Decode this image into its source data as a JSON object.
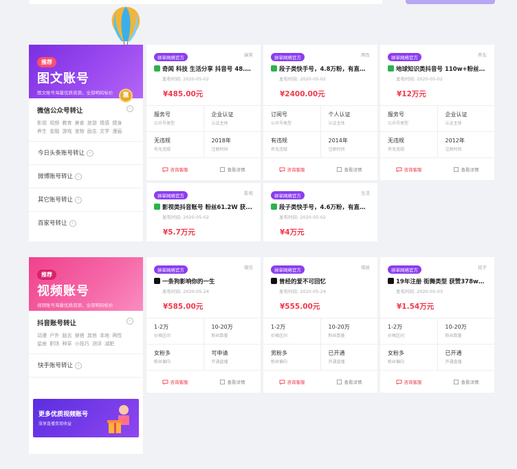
{
  "colors": {
    "accent": "#f0394b",
    "purple": "#8a3df0",
    "pink": "#f0428c",
    "background": "#f1f2f5"
  },
  "graphic": {
    "balloon_badge": "惠"
  },
  "sections": [
    {
      "banner": {
        "tag": "推荐",
        "title": "图文账号",
        "subtitle": "图文账号海量优质资源，全部明码标价"
      },
      "main_category": {
        "label": "微信公众号转让",
        "tags_line1": "影视 视频 教育 美食 旅游 情感 健身",
        "tags_line2": "养生 金融 游戏 宠物 励志 文学 漫画"
      },
      "items": [
        "今日头条账号转让",
        "微博账号转让",
        "其它账号转让",
        "百家号转让"
      ],
      "cards": [
        {
          "tag": "拼单网络官方",
          "category": "搞笑",
          "name": "奇闻 科技 生活分享 抖音号 48.8 ...",
          "date": "发布时间: 2020-05-02",
          "price": "¥485.00元",
          "c1v": "服务号",
          "c1l": "公众号类型",
          "c2v": "企业认证",
          "c2l": "认证主体",
          "c3v": "无违规",
          "c3l": "有无违规",
          "c4v": "2018年",
          "c4l": "注册时间"
        },
        {
          "tag": "拼单网络官方",
          "category": "两性",
          "name": "段子类快手号，4.8万粉，有直播...",
          "date": "发布时间: 2020-05-02",
          "price": "¥2400.00元",
          "c1v": "订阅号",
          "c1l": "公众号类型",
          "c2v": "个人认证",
          "c2l": "认证主体",
          "c3v": "有违规",
          "c3l": "有无违规",
          "c4v": "2014年",
          "c4l": "注册时间"
        },
        {
          "tag": "拼单网络官方",
          "category": "养生",
          "name": "地球知识类抖音号 110w+粉丝 ...",
          "date": "发布时间: 2020-05-02",
          "price": "¥12万元",
          "c1v": "服务号",
          "c1l": "公众号类型",
          "c2v": "企业认证",
          "c2l": "认证主体",
          "c3v": "无违规",
          "c3l": "有无违规",
          "c4v": "2012年",
          "c4l": "注册时间"
        },
        {
          "tag": "拼单网络官方",
          "category": "影视",
          "name": "影视类抖音账号 粉丝61.2W 获...",
          "date": "发布时间: 2020-05-02",
          "price": "¥5.7万元"
        },
        {
          "tag": "拼单网络官方",
          "category": "生活",
          "name": "段子类快手号，4.6万粉，有直播...",
          "date": "发布时间: 2020-05-02",
          "price": "¥4万元"
        }
      ]
    },
    {
      "banner": {
        "tag": "推荐",
        "title": "视频账号",
        "subtitle": "视频账号海量优质资源，全部明码标价"
      },
      "main_category": {
        "label": "抖音账号转让",
        "tags_line1": "动漫 户外 励志 穿搭 其他 本地 两性",
        "tags_line2": "星座 职场 种草 小技巧 测评 减肥"
      },
      "items": [
        "快手账号转让"
      ],
      "promo": {
        "title": "更多优质视频账号",
        "subtitle": "涨享直播变现收益"
      },
      "cards": [
        {
          "tag": "拼单网络官方",
          "category": "微信",
          "name": "一条狗影响你的一生",
          "date": "发布时间: 2020-05-24",
          "price": "¥585.00元",
          "c1v": "1-2万",
          "c1l": "价格区间",
          "c2v": "10-20万",
          "c2l": "粉丝数量",
          "c3v": "女粉多",
          "c3l": "粉丝偏向",
          "c4v": "可申请",
          "c4l": "开通直播"
        },
        {
          "tag": "拼单网络官方",
          "category": "萌娃",
          "name": "曾经的爱不可回忆",
          "date": "发布时间: 2020-05-24",
          "price": "¥555.00元",
          "c1v": "1-2万",
          "c1l": "价格区间",
          "c2v": "10-20万",
          "c2l": "粉丝数量",
          "c3v": "男粉多",
          "c3l": "粉丝偏向",
          "c4v": "已开通",
          "c4l": "开通直播"
        },
        {
          "tag": "拼单网络官方",
          "category": "段子",
          "name": "19年注册 街舞类型 获赞378w粉...",
          "date": "发布时间: 2020-05-03",
          "price": "¥1.54万元",
          "c1v": "1-2万",
          "c1l": "价格区间",
          "c2v": "10-20万",
          "c2l": "粉丝数量",
          "c3v": "女粉多",
          "c3l": "粉丝偏向",
          "c4v": "已开通",
          "c4l": "开通直播"
        }
      ]
    }
  ],
  "actions": {
    "consult": "咨询客服",
    "details": "查看详情"
  }
}
